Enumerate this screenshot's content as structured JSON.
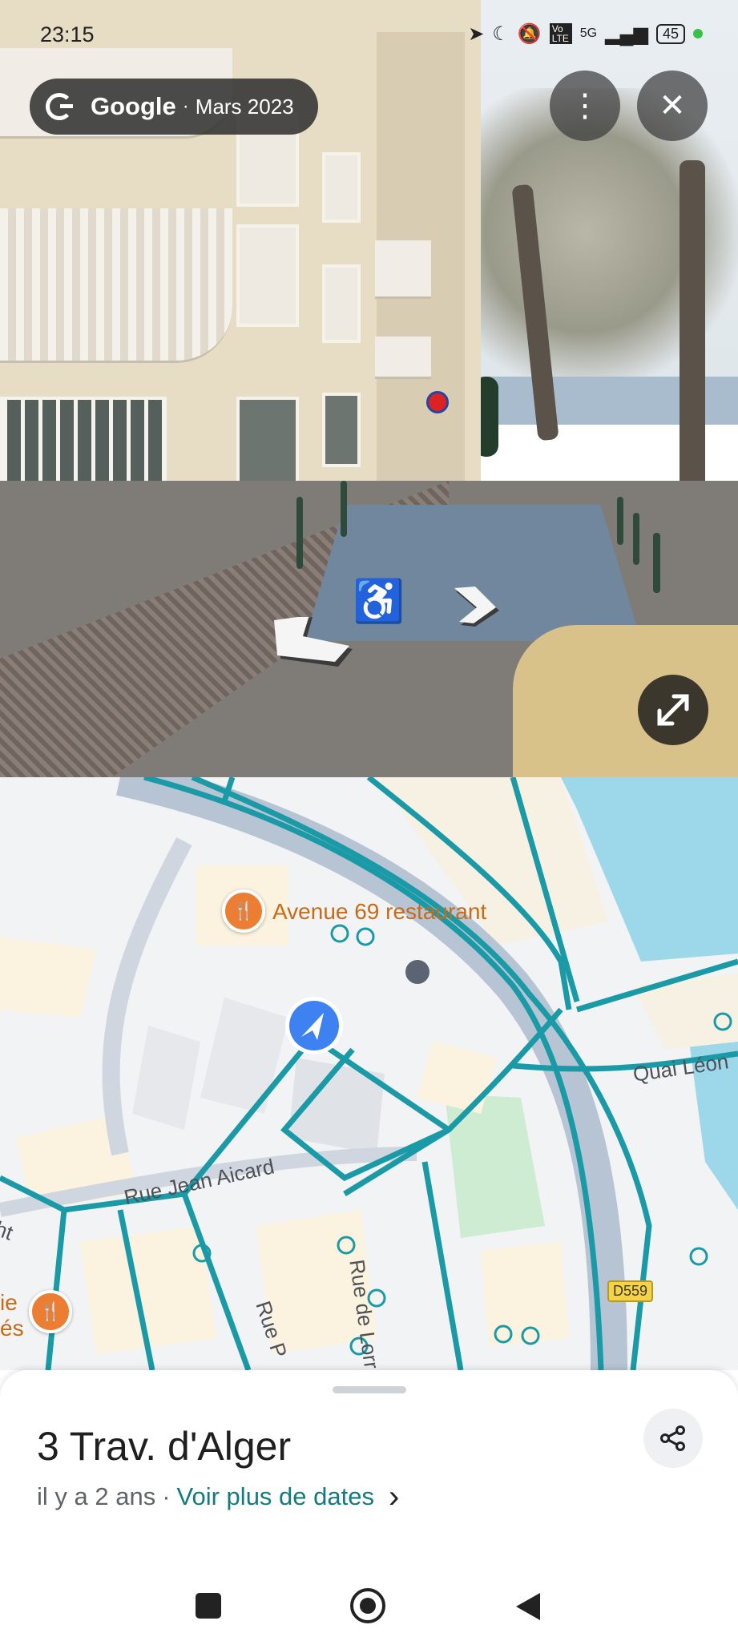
{
  "status_bar": {
    "time": "23:15",
    "icons": [
      "location-arrow-icon",
      "moon-icon",
      "mute-bell-icon",
      "volte-icon",
      "signal-5g-icon"
    ],
    "network": "5G",
    "volte": "Vo LTE",
    "battery": "45"
  },
  "street_view": {
    "provider": "Google",
    "separator": "·",
    "capture_date": "Mars 2023",
    "more_icon": "⋮",
    "close_icon": "✕"
  },
  "map": {
    "poi_restaurant": "Avenue 69 restaurant",
    "poi_partial_line1": "ie",
    "poi_partial_line2": "és",
    "street_jean_aicard": "Rue Jean Aicard",
    "street_lorr": "Rue de Lorr",
    "street_p": "Rue P",
    "quai": "Quai Léon",
    "partial_left": "ht",
    "road_shield": "D559",
    "colors": {
      "route": "#1a9aa6",
      "water": "#9dd8ea",
      "park": "#cdecd2",
      "building": "#fbf3df"
    }
  },
  "sheet": {
    "title": "3 Trav. d'Alger",
    "age": "il y a 2 ans",
    "dot": "·",
    "more_dates": "Voir plus de dates",
    "chevron": "›"
  }
}
